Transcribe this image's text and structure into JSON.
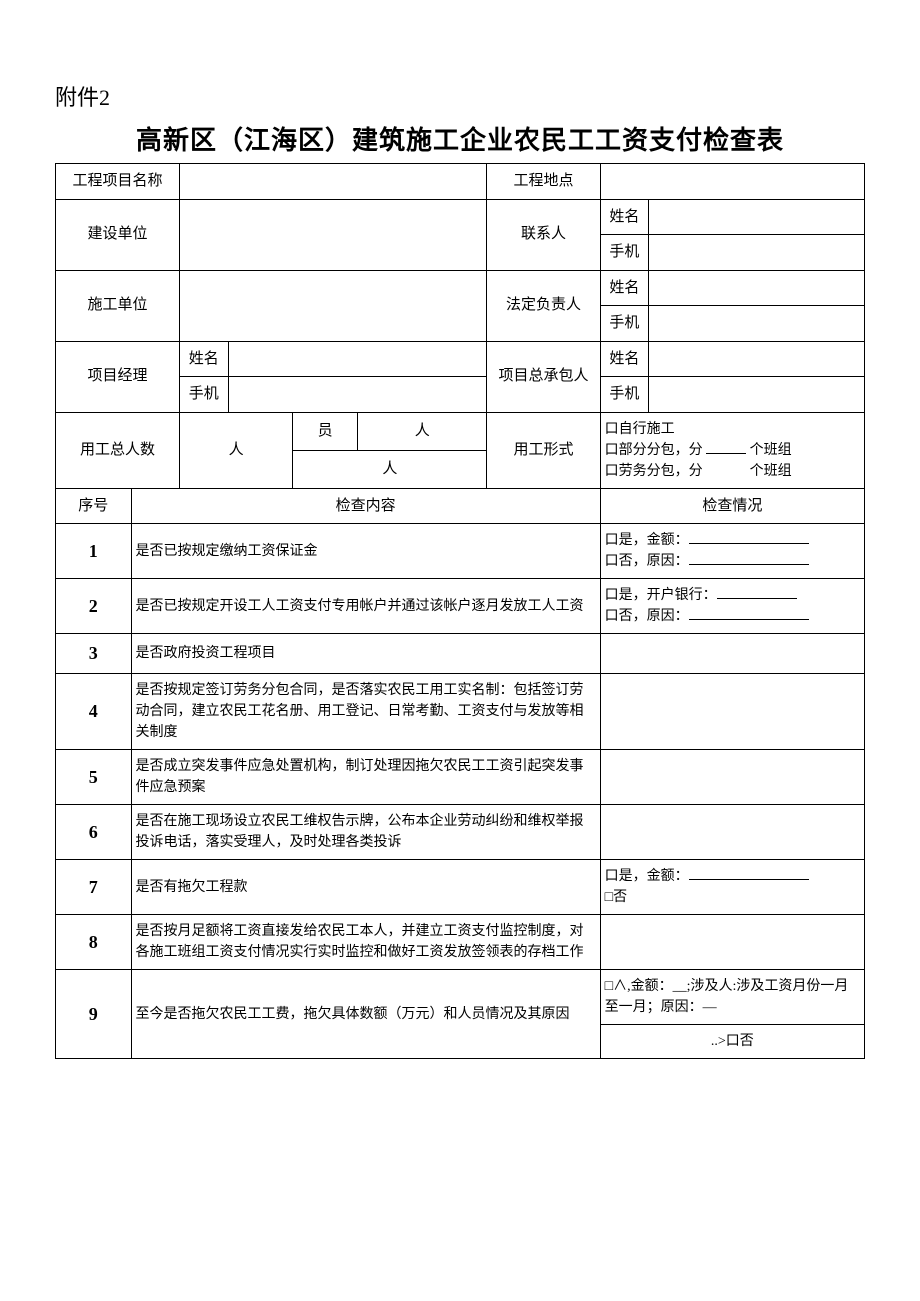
{
  "annex": "附件2",
  "title": "高新区（江海区）建筑施工企业农民工工资支付检查表",
  "labels": {
    "project_name": "工程项目名称",
    "project_location": "工程地点",
    "construction_owner": "建设单位",
    "contact": "联系人",
    "name": "姓名",
    "phone": "手机",
    "construction_unit": "施工单位",
    "legal_rep": "法定负责人",
    "project_manager": "项目经理",
    "general_contractor": "项目总承包人",
    "total_workers": "用工总人数",
    "ren": "人",
    "yuan": "员",
    "work_form": "用工形式",
    "self_construct": "口自行施工",
    "partial_sub": "口部分分包，分",
    "labor_sub": "口劳务分包，分",
    "banzu": "个班组",
    "seq": "序号",
    "inspect_content": "检查内容",
    "inspect_status": "检查情况",
    "yes_amount": "口是，金额：",
    "no_reason": "口否，原因：",
    "yes_bank": "口是，开户银行：",
    "no": "□否",
    "no2": "口否",
    "arrow": "..>",
    "check_a": "□∧,金额：__;涉及人:涉及工资月份一月至一月；原因：—"
  },
  "rows": [
    {
      "n": "1",
      "content": "是否已按规定缴纳工资保证金"
    },
    {
      "n": "2",
      "content": "是否已按规定开设工人工资支付专用帐户并通过该帐户逐月发放工人工资"
    },
    {
      "n": "3",
      "content": "是否政府投资工程项目"
    },
    {
      "n": "4",
      "content": "是否按规定签订劳务分包合同，是否落实农民工用工实名制：包括签订劳动合同，建立农民工花名册、用工登记、日常考勤、工资支付与发放等相关制度"
    },
    {
      "n": "5",
      "content": "是否成立突发事件应急处置机构，制订处理因拖欠农民工工资引起突发事件应急预案"
    },
    {
      "n": "6",
      "content": "是否在施工现场设立农民工维权告示牌，公布本企业劳动纠纷和维权举报投诉电话，落实受理人，及时处理各类投诉"
    },
    {
      "n": "7",
      "content": "是否有拖欠工程款"
    },
    {
      "n": "8",
      "content": "是否按月足额将工资直接发给农民工本人，并建立工资支付监控制度，对各施工班组工资支付情况实行实时监控和做好工资发放签领表的存档工作"
    },
    {
      "n": "9",
      "content": "至今是否拖欠农民工工费，拖欠具体数额（万元）和人员情况及其原因"
    }
  ]
}
